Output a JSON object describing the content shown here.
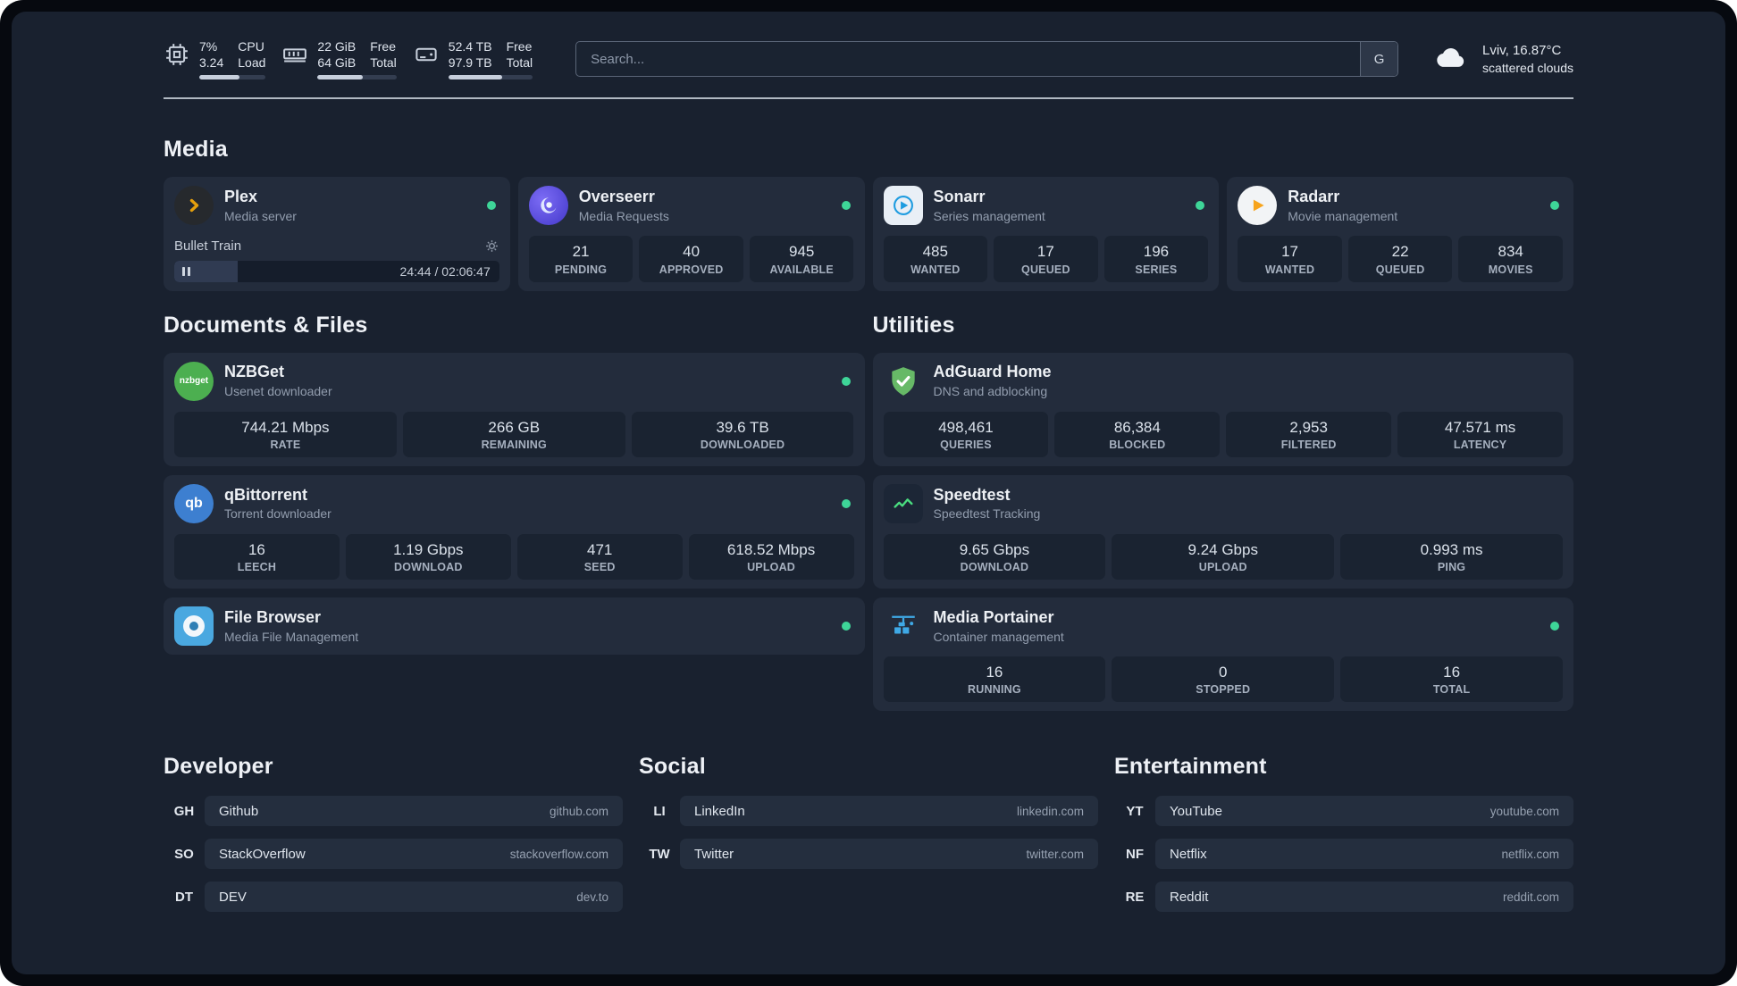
{
  "topbar": {
    "cpu": {
      "v1": "7%",
      "v2": "3.24",
      "l1": "CPU",
      "l2": "Load",
      "bar_style": "width:60%"
    },
    "memory": {
      "v1": "22 GiB",
      "v2": "64 GiB",
      "l1": "Free",
      "l2": "Total",
      "bar_style": "width:57%"
    },
    "disk": {
      "v1": "52.4 TB",
      "v2": "97.9 TB",
      "l1": "Free",
      "l2": "Total",
      "bar_style": "width:64%"
    },
    "search": {
      "placeholder": "Search...",
      "provider": "G"
    },
    "weather": {
      "location": "Lviv, 16.87°C",
      "condition": "scattered clouds"
    }
  },
  "media": {
    "title": "Media",
    "plex": {
      "name": "Plex",
      "subtitle": "Media server",
      "track": "Bullet Train",
      "time": "24:44 / 02:06:47",
      "progress_style": "width:19.5%"
    },
    "overseerr": {
      "name": "Overseerr",
      "subtitle": "Media Requests",
      "stats": [
        {
          "v": "21",
          "l": "PENDING"
        },
        {
          "v": "40",
          "l": "APPROVED"
        },
        {
          "v": "945",
          "l": "AVAILABLE"
        }
      ]
    },
    "sonarr": {
      "name": "Sonarr",
      "subtitle": "Series management",
      "stats": [
        {
          "v": "485",
          "l": "WANTED"
        },
        {
          "v": "17",
          "l": "QUEUED"
        },
        {
          "v": "196",
          "l": "SERIES"
        }
      ]
    },
    "radarr": {
      "name": "Radarr",
      "subtitle": "Movie management",
      "stats": [
        {
          "v": "17",
          "l": "WANTED"
        },
        {
          "v": "22",
          "l": "QUEUED"
        },
        {
          "v": "834",
          "l": "MOVIES"
        }
      ]
    }
  },
  "documents": {
    "title": "Documents & Files",
    "nzbget": {
      "name": "NZBGet",
      "subtitle": "Usenet downloader",
      "stats": [
        {
          "v": "744.21 Mbps",
          "l": "RATE"
        },
        {
          "v": "266 GB",
          "l": "REMAINING"
        },
        {
          "v": "39.6 TB",
          "l": "DOWNLOADED"
        }
      ]
    },
    "qbittorrent": {
      "name": "qBittorrent",
      "subtitle": "Torrent downloader",
      "stats": [
        {
          "v": "16",
          "l": "LEECH"
        },
        {
          "v": "1.19 Gbps",
          "l": "DOWNLOAD"
        },
        {
          "v": "471",
          "l": "SEED"
        },
        {
          "v": "618.52 Mbps",
          "l": "UPLOAD"
        }
      ]
    },
    "filebrowser": {
      "name": "File Browser",
      "subtitle": "Media File Management"
    }
  },
  "utilities": {
    "title": "Utilities",
    "adguard": {
      "name": "AdGuard Home",
      "subtitle": "DNS and adblocking",
      "stats": [
        {
          "v": "498,461",
          "l": "QUERIES"
        },
        {
          "v": "86,384",
          "l": "BLOCKED"
        },
        {
          "v": "2,953",
          "l": "FILTERED"
        },
        {
          "v": "47.571 ms",
          "l": "LATENCY"
        }
      ]
    },
    "speedtest": {
      "name": "Speedtest",
      "subtitle": "Speedtest Tracking",
      "stats": [
        {
          "v": "9.65 Gbps",
          "l": "DOWNLOAD"
        },
        {
          "v": "9.24 Gbps",
          "l": "UPLOAD"
        },
        {
          "v": "0.993 ms",
          "l": "PING"
        }
      ]
    },
    "portainer": {
      "name": "Media Portainer",
      "subtitle": "Container management",
      "stats": [
        {
          "v": "16",
          "l": "RUNNING"
        },
        {
          "v": "0",
          "l": "STOPPED"
        },
        {
          "v": "16",
          "l": "TOTAL"
        }
      ]
    }
  },
  "bookmarks": {
    "developer": {
      "title": "Developer",
      "items": [
        {
          "abbr": "GH",
          "name": "Github",
          "url": "github.com"
        },
        {
          "abbr": "SO",
          "name": "StackOverflow",
          "url": "stackoverflow.com"
        },
        {
          "abbr": "DT",
          "name": "DEV",
          "url": "dev.to"
        }
      ]
    },
    "social": {
      "title": "Social",
      "items": [
        {
          "abbr": "LI",
          "name": "LinkedIn",
          "url": "linkedin.com"
        },
        {
          "abbr": "TW",
          "name": "Twitter",
          "url": "twitter.com"
        }
      ]
    },
    "entertainment": {
      "title": "Entertainment",
      "items": [
        {
          "abbr": "YT",
          "name": "YouTube",
          "url": "youtube.com"
        },
        {
          "abbr": "NF",
          "name": "Netflix",
          "url": "netflix.com"
        },
        {
          "abbr": "RE",
          "name": "Reddit",
          "url": "reddit.com"
        }
      ]
    }
  },
  "icons": {
    "nzbget_label": "nzbget",
    "qb_label": "qb"
  }
}
